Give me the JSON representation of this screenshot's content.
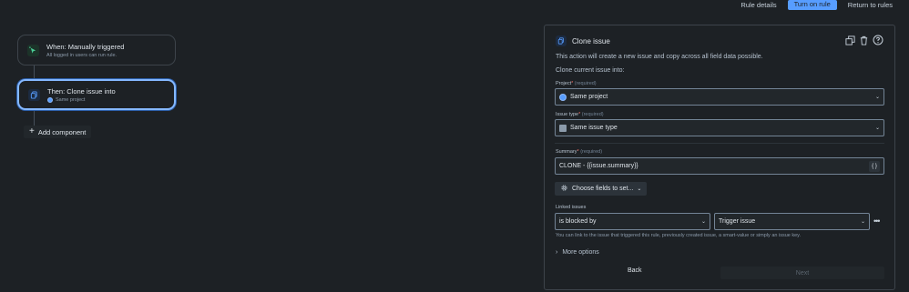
{
  "topbar": {
    "rule_details": "Rule details",
    "turn_on_rule": "Turn on rule",
    "return_to_rules": "Return to rules"
  },
  "canvas": {
    "trigger": {
      "title": "When: Manually triggered",
      "subtitle": "All logged in users can run rule."
    },
    "action": {
      "title": "Then: Clone issue into",
      "subtitle": "Same project"
    },
    "add_component": "Add component"
  },
  "panel": {
    "title": "Clone issue",
    "description": "This action will create a new issue and copy across all field data possible.",
    "clone_into": "Clone current issue into:",
    "project": {
      "label": "Project",
      "required_mark": "*",
      "hint": "(required)",
      "value": "Same project"
    },
    "issue_type": {
      "label": "Issue type",
      "required_mark": "*",
      "hint": "(required)",
      "value": "Same issue type"
    },
    "summary": {
      "label": "Summary",
      "required_mark": "*",
      "hint": "(required)",
      "value": "CLONE - {{issue.summary}}",
      "smart_value_icon": "{ }"
    },
    "choose_fields": "Choose fields to set...",
    "linked_issues": {
      "label": "Linked issues",
      "link_type": "is blocked by",
      "target": "Trigger issue",
      "more": "•••",
      "helper": "You can link to the issue that triggered this rule, previously created issue, a smart-value or simply an issue key."
    },
    "more_options": "More options",
    "back": "Back",
    "next": "Next"
  }
}
